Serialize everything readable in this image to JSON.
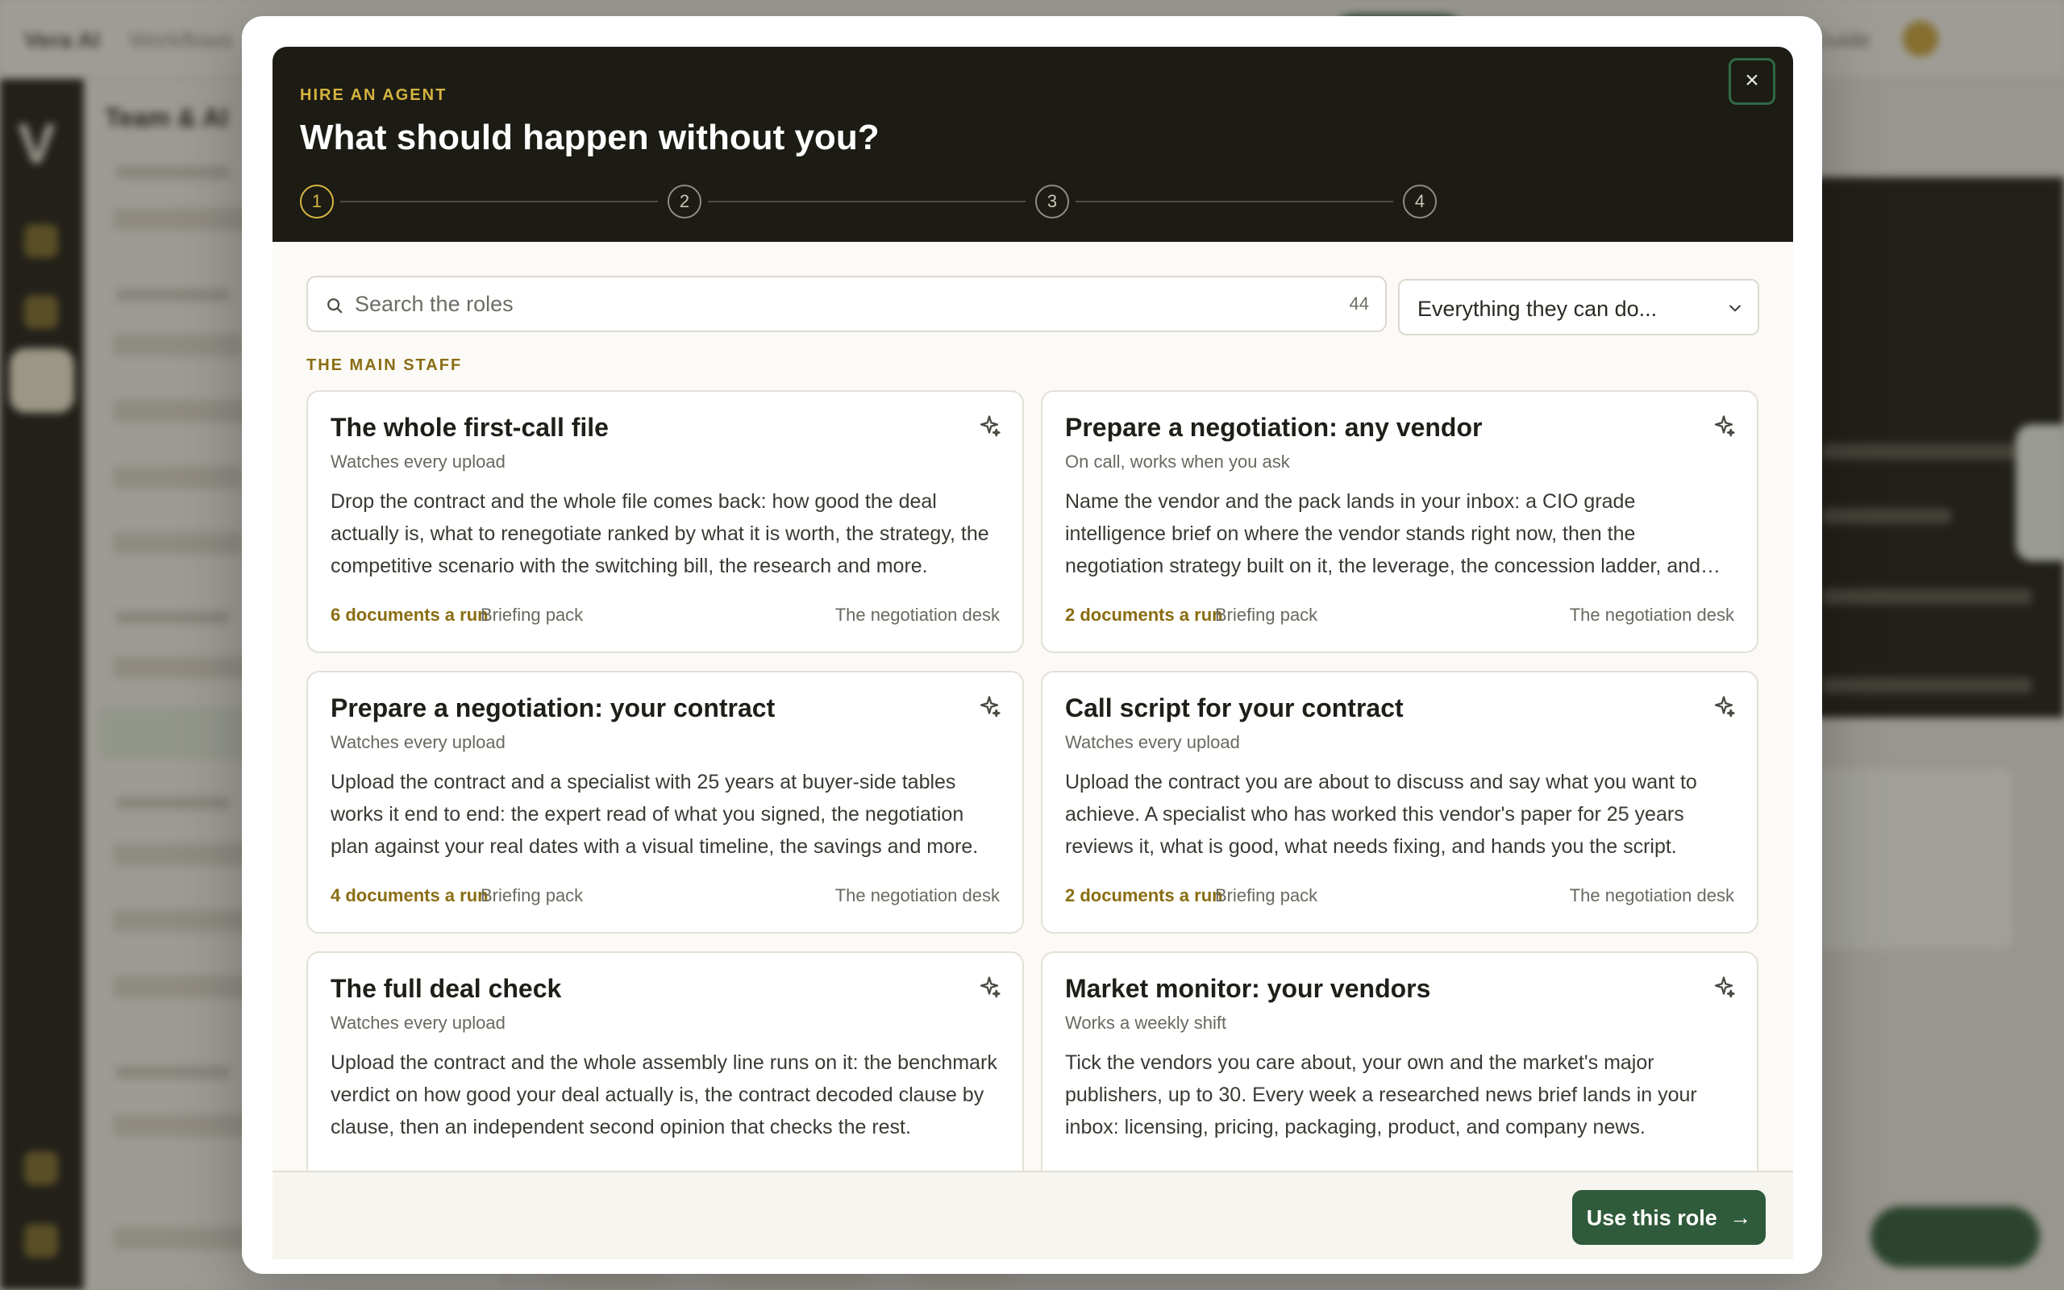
{
  "background": {
    "breadcrumb_app": "Vera AI",
    "breadcrumb_page": "Workflows",
    "sidebar_title": "Team & AI",
    "guide_label": "Guide"
  },
  "modal": {
    "kicker": "HIRE AN AGENT",
    "title": "What should happen without you?",
    "close_label": "×",
    "steps": [
      "1",
      "2",
      "3",
      "4"
    ],
    "current_step": 1
  },
  "search": {
    "placeholder": "Search the roles",
    "count": "44"
  },
  "filter": {
    "selected": "Everything they can do..."
  },
  "section_label": "THE MAIN STAFF",
  "cards": [
    {
      "title": "The whole first-call file",
      "subtitle": "Watches every upload",
      "description": "Drop the contract and the whole file comes back: how good the deal actually is, what to renegotiate ranked by what it is worth, the strategy, the competitive scenario with the switching bill, the research and more.",
      "docs": "6 documents a run",
      "pack": "Briefing pack",
      "desk": "The negotiation desk"
    },
    {
      "title": "Prepare a negotiation: any vendor",
      "subtitle": "On call, works when you ask",
      "description": "Name the vendor and the pack lands in your inbox: a CIO grade intelligence brief on where the vendor stands right now, then the negotiation strategy built on it, the leverage, the concession ladder, and more.",
      "docs": "2 documents a run",
      "pack": "Briefing pack",
      "desk": "The negotiation desk"
    },
    {
      "title": "Prepare a negotiation: your contract",
      "subtitle": "Watches every upload",
      "description": "Upload the contract and a specialist with 25 years at buyer-side tables works it end to end: the expert read of what you signed, the negotiation plan against your real dates with a visual timeline, the savings and more.",
      "docs": "4 documents a run",
      "pack": "Briefing pack",
      "desk": "The negotiation desk"
    },
    {
      "title": "Call script for your contract",
      "subtitle": "Watches every upload",
      "description": "Upload the contract you are about to discuss and say what you want to achieve. A specialist who has worked this vendor's paper for 25 years reviews it, what is good, what needs fixing, and hands you the script.",
      "docs": "2 documents a run",
      "pack": "Briefing pack",
      "desk": "The negotiation desk"
    },
    {
      "title": "The full deal check",
      "subtitle": "Watches every upload",
      "description": "Upload the contract and the whole assembly line runs on it: the benchmark verdict on how good your deal actually is, the contract decoded clause by clause, then an independent second opinion that checks the rest.",
      "docs": "",
      "pack": "",
      "desk": ""
    },
    {
      "title": "Market monitor: your vendors",
      "subtitle": "Works a weekly shift",
      "description": "Tick the vendors you care about, your own and the market's major publishers, up to 30. Every week a researched news brief lands in your inbox: licensing, pricing, packaging, product, and company news.",
      "docs": "",
      "pack": "",
      "desk": ""
    }
  ],
  "footer": {
    "use_label": "Use this role",
    "use_arrow": "→"
  },
  "colors": {
    "accent_gold": "#d6b440",
    "label_gold": "#8a6d12",
    "primary_green": "#2f5b3a",
    "header_dark": "#1c1b14"
  }
}
